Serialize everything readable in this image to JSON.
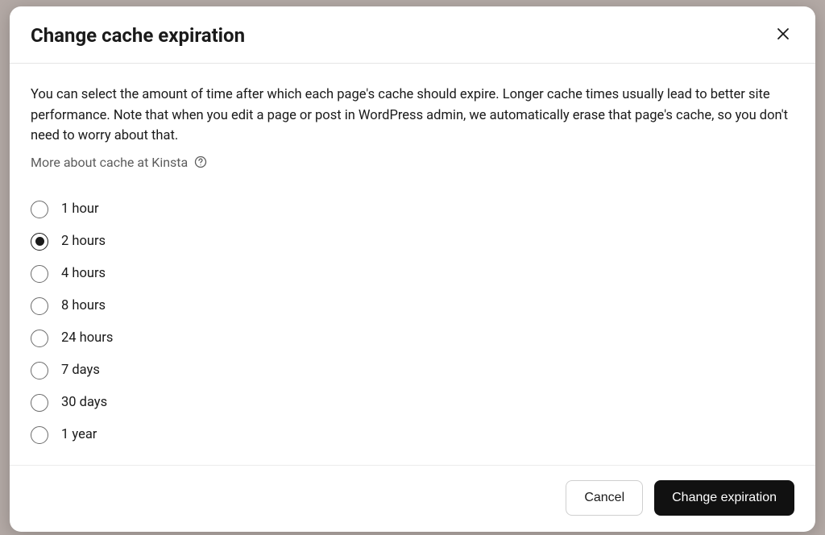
{
  "modal": {
    "title": "Change cache expiration",
    "description": "You can select the amount of time after which each page's cache should expire. Longer cache times usually lead to better site performance. Note that when you edit a page or post in WordPress admin, we automatically erase that page's cache, so you don't need to worry about that.",
    "help_link": "More about cache at Kinsta",
    "options": [
      {
        "label": "1 hour",
        "selected": false
      },
      {
        "label": "2 hours",
        "selected": true
      },
      {
        "label": "4 hours",
        "selected": false
      },
      {
        "label": "8 hours",
        "selected": false
      },
      {
        "label": "24 hours",
        "selected": false
      },
      {
        "label": "7 days",
        "selected": false
      },
      {
        "label": "30 days",
        "selected": false
      },
      {
        "label": "1 year",
        "selected": false
      }
    ],
    "buttons": {
      "cancel": "Cancel",
      "confirm": "Change expiration"
    }
  }
}
